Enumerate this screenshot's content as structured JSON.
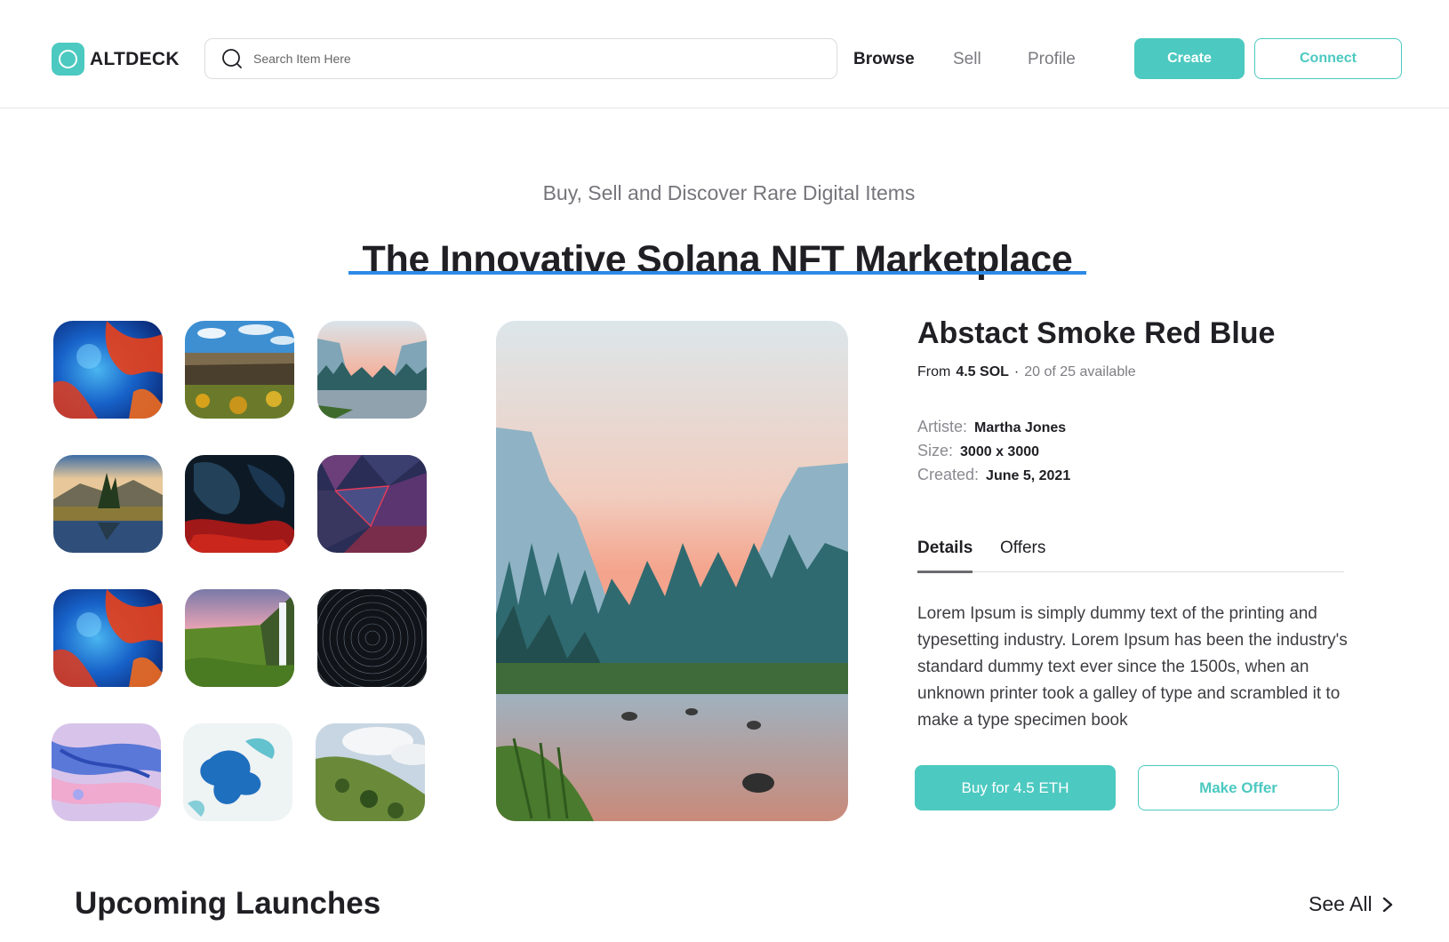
{
  "header": {
    "brand": "ALTDECK",
    "search_placeholder": "Search Item Here",
    "nav": [
      {
        "label": "Browse",
        "active": true
      },
      {
        "label": "Sell",
        "active": false
      },
      {
        "label": "Profile",
        "active": false
      }
    ],
    "create_label": "Create",
    "connect_label": "Connect"
  },
  "hero": {
    "tagline": "Buy, Sell and Discover Rare Digital Items",
    "title": "The Innovative Solana NFT Marketplace"
  },
  "gallery": {
    "thumbnails": [
      "abstract-smoke-red-blue",
      "canyon-cliffs",
      "mountain-valley-river",
      "lake-reflection-sunset",
      "dark-smoke-red",
      "geometric-polygons-red",
      "abstract-smoke-red-blue",
      "waterfall-green-hills",
      "star-trails-night",
      "pastel-fluid-marble",
      "blue-ink-splash",
      "green-hillside-clouds"
    ],
    "featured_image": "mountain-valley-river-sunset"
  },
  "item": {
    "title": "Abstact Smoke Red Blue",
    "price_prefix": "From",
    "price": "4.5 SOL",
    "separator": "·",
    "availability": "20 of 25 available",
    "meta": [
      {
        "key": "Artiste:",
        "value": "Martha Jones"
      },
      {
        "key": "Size:",
        "value": "3000 x 3000"
      },
      {
        "key": "Created:",
        "value": "June 5, 2021"
      }
    ],
    "tabs": [
      {
        "label": "Details",
        "active": true
      },
      {
        "label": "Offers",
        "active": false
      }
    ],
    "description": "Lorem Ipsum is simply dummy text of the printing and typesetting industry. Lorem Ipsum has been the industry's standard dummy text ever since the 1500s, when an unknown printer took a galley of type and scrambled it to make a type specimen book",
    "buy_label": "Buy for 4.5 ETH",
    "offer_label": "Make Offer"
  },
  "upcoming": {
    "title": "Upcoming Launches",
    "see_all": "See All"
  },
  "colors": {
    "accent": "#4cc9c0",
    "underline": "#2d8ae6",
    "text": "#1f1f24",
    "muted": "#7d7d83"
  }
}
